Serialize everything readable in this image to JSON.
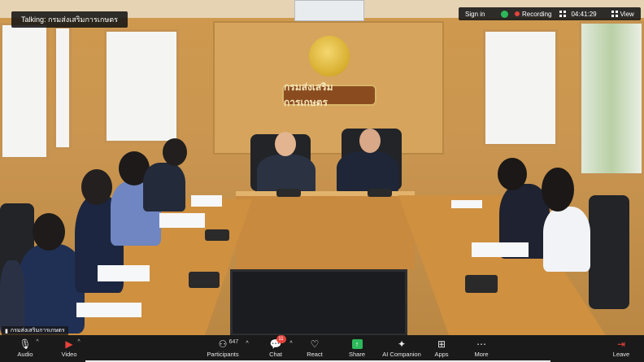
{
  "video": {
    "speaker_banner": "Talking: กรมส่งเสริมการเกษตร",
    "wall_sign": "กรมส่งเสริมการเกษตร",
    "participant_name": "กรมส่งเสริมการเกษตร"
  },
  "topbar": {
    "sign_in": "Sign in",
    "recording": "Recording",
    "time": "04:41:29",
    "view": "View"
  },
  "toolbar": {
    "audio": {
      "label": "Audio",
      "icon": "microphone-icon"
    },
    "video": {
      "label": "Video",
      "icon": "video-camera-icon"
    },
    "participants": {
      "label": "Participants",
      "count": "647",
      "icon": "participants-icon"
    },
    "chat": {
      "label": "Chat",
      "badge": "11",
      "icon": "chat-icon"
    },
    "react": {
      "label": "React",
      "icon": "heart-icon"
    },
    "share": {
      "label": "Share",
      "icon": "share-arrow-icon"
    },
    "ai_companion": {
      "label": "AI Companion",
      "icon": "sparkle-icon"
    },
    "apps": {
      "label": "Apps",
      "icon": "apps-icon"
    },
    "more": {
      "label": "More",
      "icon": "more-dots-icon"
    },
    "leave": {
      "label": "Leave",
      "icon": "leave-door-icon"
    }
  },
  "colors": {
    "toolbar_bg": "#1a1a1a",
    "recording_red": "#e5433b",
    "share_green": "#2db85a",
    "leave_red": "#e5433b"
  }
}
